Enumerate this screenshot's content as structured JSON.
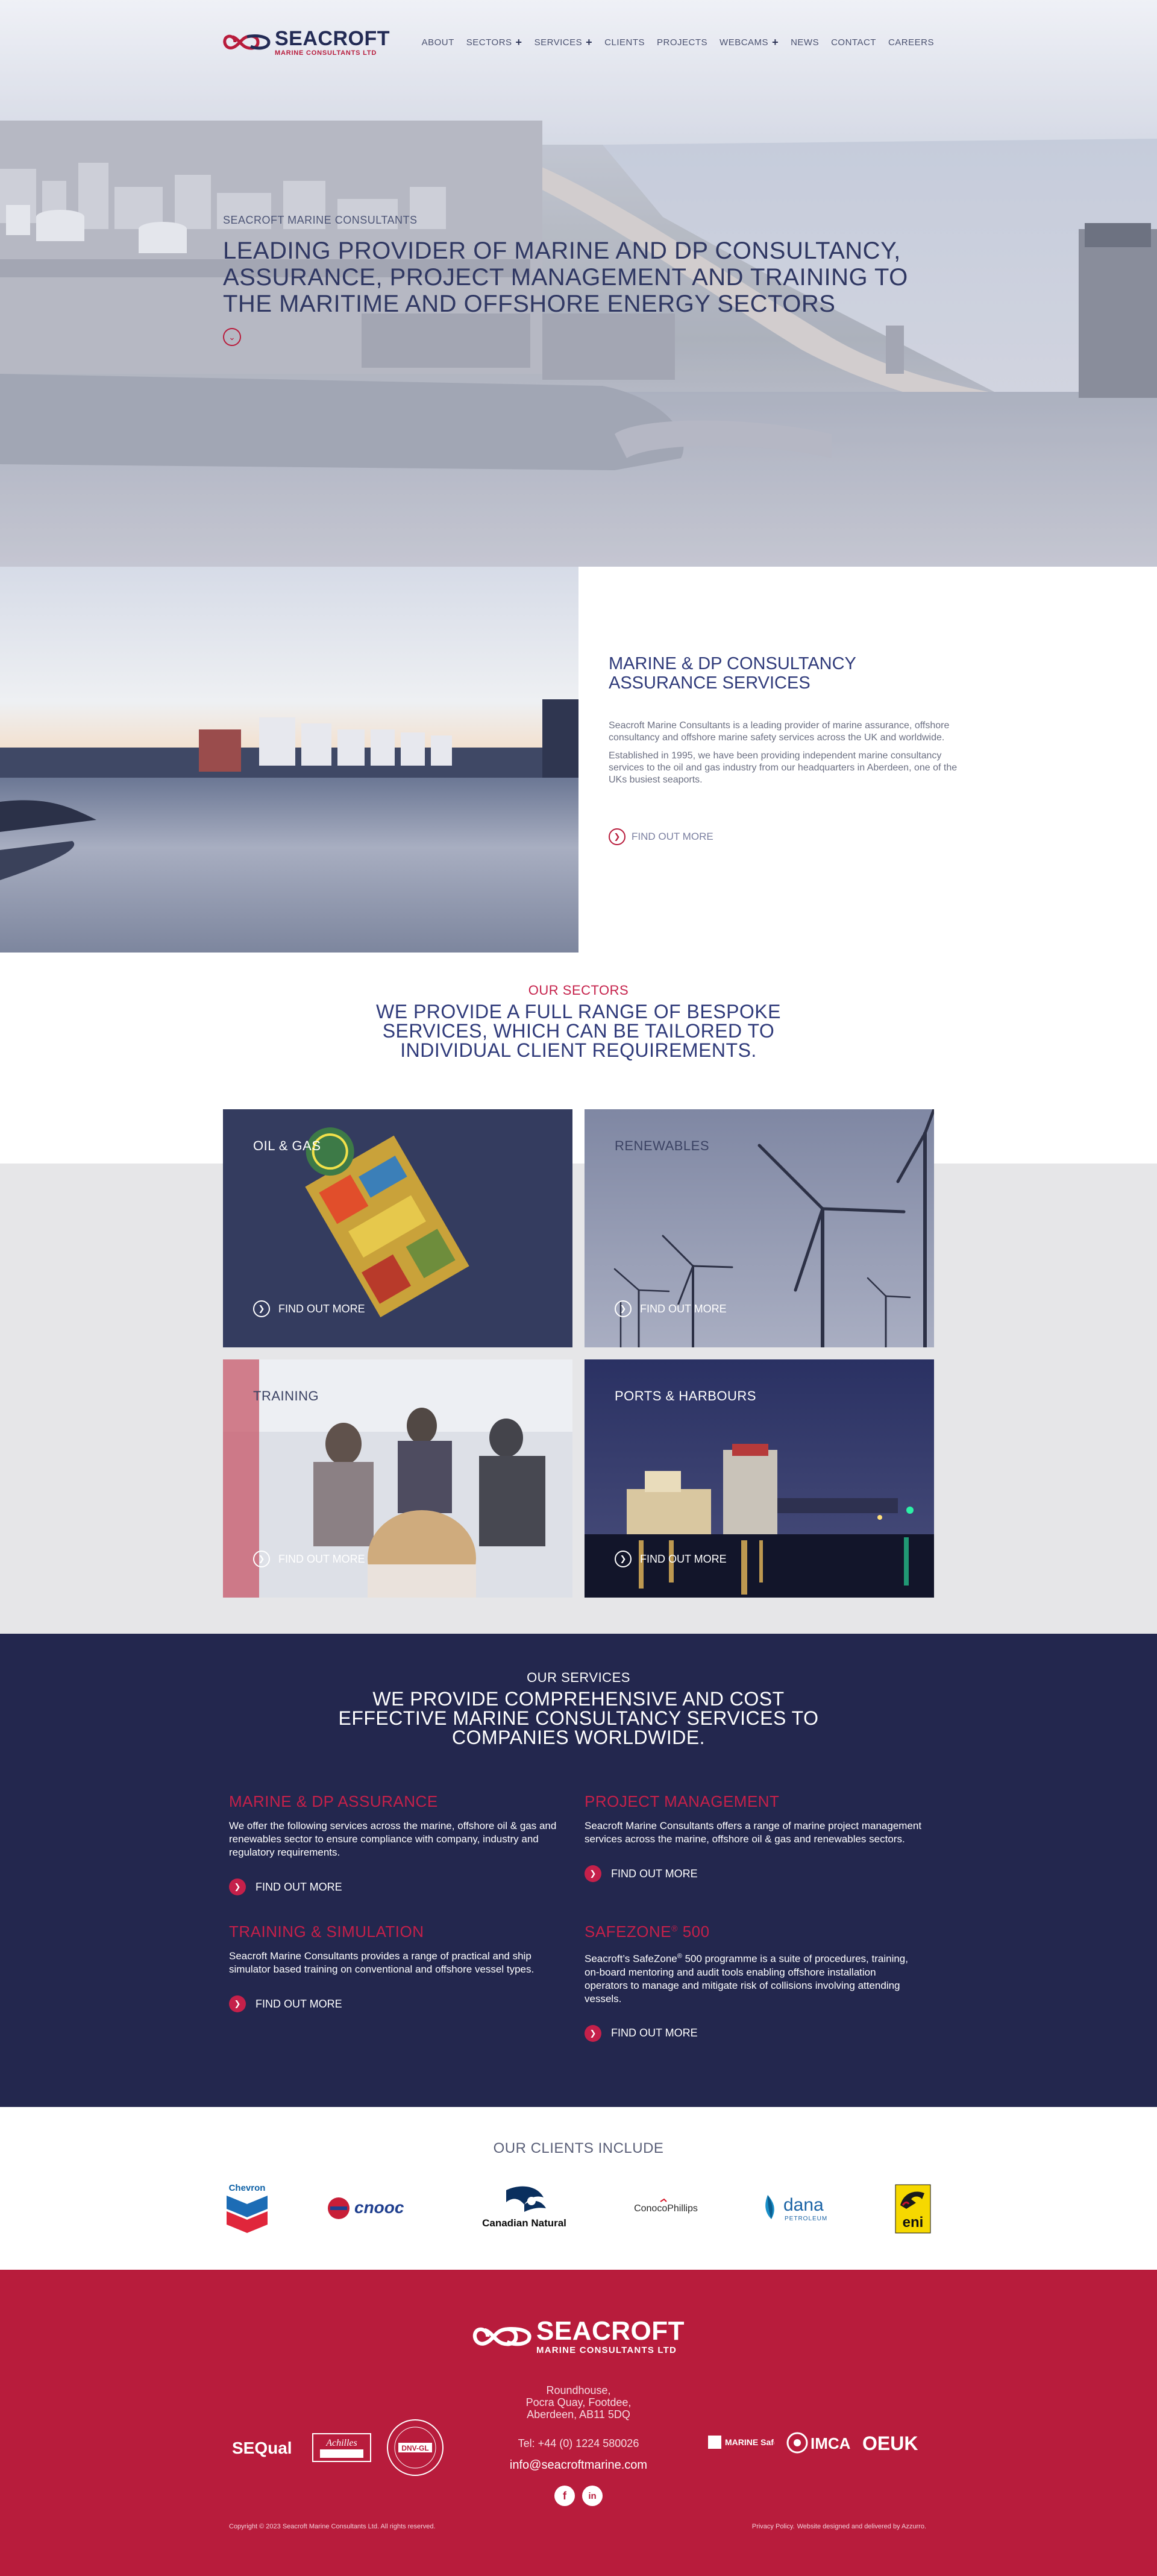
{
  "brand": {
    "name": "SEACROFT",
    "sub": "MARINE CONSULTANTS LTD",
    "colors": {
      "navy": "#232b55",
      "red": "#b81c3c"
    }
  },
  "nav": {
    "items": [
      {
        "label": "ABOUT",
        "has_submenu": false
      },
      {
        "label": "SECTORS",
        "has_submenu": true
      },
      {
        "label": "SERVICES",
        "has_submenu": true
      },
      {
        "label": "CLIENTS",
        "has_submenu": false
      },
      {
        "label": "PROJECTS",
        "has_submenu": false
      },
      {
        "label": "WEBCAMS",
        "has_submenu": true
      },
      {
        "label": "NEWS",
        "has_submenu": false
      },
      {
        "label": "CONTACT",
        "has_submenu": false
      },
      {
        "label": "CAREERS",
        "has_submenu": false
      }
    ],
    "submenu_icon": "+"
  },
  "hero": {
    "kicker": "SEACROFT MARINE CONSULTANTS",
    "title": "LEADING PROVIDER OF MARINE AND DP CONSULTANCY, ASSURANCE, PROJECT MANAGEMENT AND TRAINING TO THE MARITIME AND OFFSHORE ENERGY SECTORS",
    "scroll_icon": "chevron-down-icon"
  },
  "intro": {
    "title": "MARINE & DP CONSULTANCY ASSURANCE SERVICES",
    "paragraphs": [
      "Seacroft Marine Consultants is a leading provider of marine assurance, offshore consultancy and offshore marine safety services across the UK and worldwide.",
      "Established in 1995, we have been providing independent marine consultancy services to the oil and gas industry from our headquarters in Aberdeen, one of the UKs busiest seaports."
    ],
    "link": "FIND OUT MORE"
  },
  "sectors": {
    "kicker": "OUR SECTORS",
    "title": "WE PROVIDE A FULL RANGE OF BESPOKE SERVICES, WHICH CAN BE TAILORED TO INDIVIDUAL CLIENT REQUIREMENTS.",
    "tiles": [
      {
        "label": "OIL & GAS",
        "link": "FIND OUT MORE"
      },
      {
        "label": "RENEWABLES",
        "link": "FIND OUT MORE"
      },
      {
        "label": "TRAINING",
        "link": "FIND OUT MORE"
      },
      {
        "label": "PORTS & HARBOURS",
        "link": "FIND OUT MORE"
      }
    ]
  },
  "services": {
    "kicker": "OUR SERVICES",
    "title": "WE PROVIDE COMPREHENSIVE AND COST EFFECTIVE MARINE CONSULTANCY SERVICES TO COMPANIES WORLDWIDE.",
    "items": [
      {
        "title": "MARINE & DP ASSURANCE",
        "text": "We offer the following services across the marine, offshore oil & gas and renewables sector to ensure compliance with company, industry and regulatory requirements.",
        "link": "FIND OUT MORE"
      },
      {
        "title": "PROJECT MANAGEMENT",
        "text": "Seacroft Marine Consultants offers a range of marine project management services across the marine, offshore oil & gas and renewables sectors.",
        "link": "FIND OUT MORE"
      },
      {
        "title": "TRAINING & SIMULATION",
        "text": "Seacroft Marine Consultants provides a range of practical and ship simulator based training on conventional and offshore vessel types.",
        "link": "FIND OUT MORE"
      },
      {
        "title_main": "SAFEZONE",
        "title_sup": "®",
        "title_tail": " 500",
        "text_a": "Seacroft’s SafeZone",
        "text_sup": "®",
        "text_b": " 500 programme is a suite of procedures, training, on-board mentoring and audit tools enabling offshore installation operators to manage and mitigate risk of collisions involving attending vessels.",
        "link": "FIND OUT MORE"
      }
    ]
  },
  "clients": {
    "title": "OUR CLIENTS INCLUDE",
    "logos": [
      {
        "name": "Chevron",
        "icon": "chevron-logo"
      },
      {
        "name": "cnooc",
        "icon": "cnooc-logo"
      },
      {
        "name": "Canadian Natural",
        "icon": "canadian-natural-logo"
      },
      {
        "name": "ConocoPhillips",
        "icon": "conocophillips-logo"
      },
      {
        "name": "dana",
        "sub": "PETROLEUM",
        "icon": "dana-logo"
      },
      {
        "name": "eni",
        "icon": "eni-logo"
      }
    ]
  },
  "footer": {
    "address": [
      "Roundhouse,",
      "Pocra Quay, Footdee,",
      "Aberdeen, AB11 5DQ"
    ],
    "phone": "Tel: +44 (0) 1224 580026",
    "email": "info@seacroftmarine.com",
    "social": [
      {
        "name": "facebook",
        "glyph": "f"
      },
      {
        "name": "linkedin",
        "glyph": "in"
      }
    ],
    "accreditations_left": [
      "SEQual",
      "Achilles",
      "DNV-GL"
    ],
    "accreditations_right": [
      "MARINE Safety Forum",
      "IMCA",
      "OEUK"
    ],
    "copyright": "Copyright © 2023 Seacroft Marine Consultants Ltd. All rights reserved.",
    "privacy": "Privacy Policy.",
    "credit": "Website designed and delivered by Azzurro."
  }
}
